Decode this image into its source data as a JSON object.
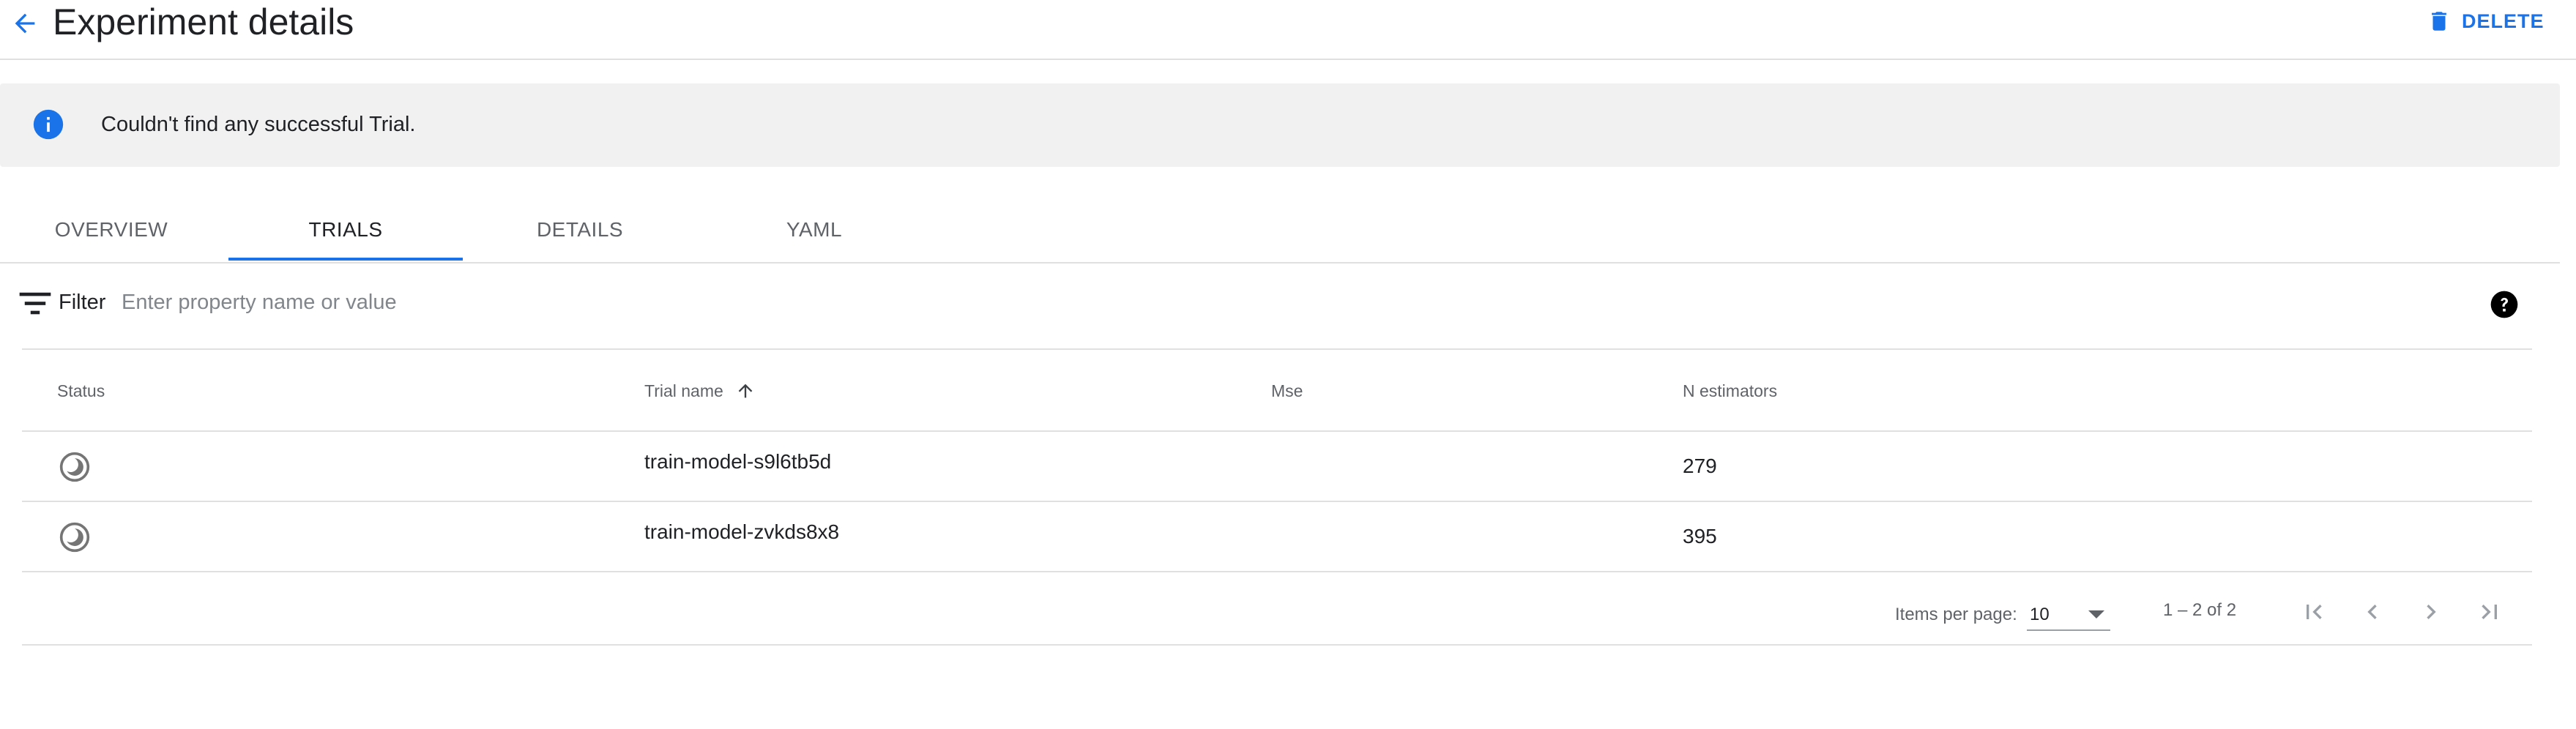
{
  "header": {
    "title": "Experiment details",
    "delete_label": "DELETE"
  },
  "banner": {
    "message": "Couldn't find any successful Trial."
  },
  "tabs": [
    {
      "label": "OVERVIEW",
      "active": false
    },
    {
      "label": "TRIALS",
      "active": true
    },
    {
      "label": "DETAILS",
      "active": false
    },
    {
      "label": "YAML",
      "active": false
    }
  ],
  "filter": {
    "label": "Filter",
    "placeholder": "Enter property name or value"
  },
  "table": {
    "columns": [
      "Status",
      "Trial name",
      "Mse",
      "N estimators"
    ],
    "sort_column": "Trial name",
    "sort_direction": "ascending",
    "rows": [
      {
        "status": "running",
        "trial_name": "train-model-s9l6tb5d",
        "mse": "",
        "n_estimators": "279"
      },
      {
        "status": "running",
        "trial_name": "train-model-zvkds8x8",
        "mse": "",
        "n_estimators": "395"
      }
    ]
  },
  "paginator": {
    "items_per_page_label": "Items per page:",
    "page_size": "10",
    "range_label": "1 – 2 of 2"
  },
  "colors": {
    "accent": "#1a73e8",
    "banner_bg": "#f1f1f1",
    "divider": "#e0e0e0",
    "text_primary": "#202124",
    "text_secondary": "#5f6368"
  },
  "icons": {
    "back": "arrow-left-icon",
    "delete": "trash-icon",
    "info": "info-icon",
    "filter": "filter-list-icon",
    "help": "help-icon",
    "sort": "arrow-up-icon",
    "status": "running-status-icon",
    "first_page": "first-page-icon",
    "prev_page": "chevron-left-icon",
    "next_page": "chevron-right-icon",
    "last_page": "last-page-icon"
  }
}
